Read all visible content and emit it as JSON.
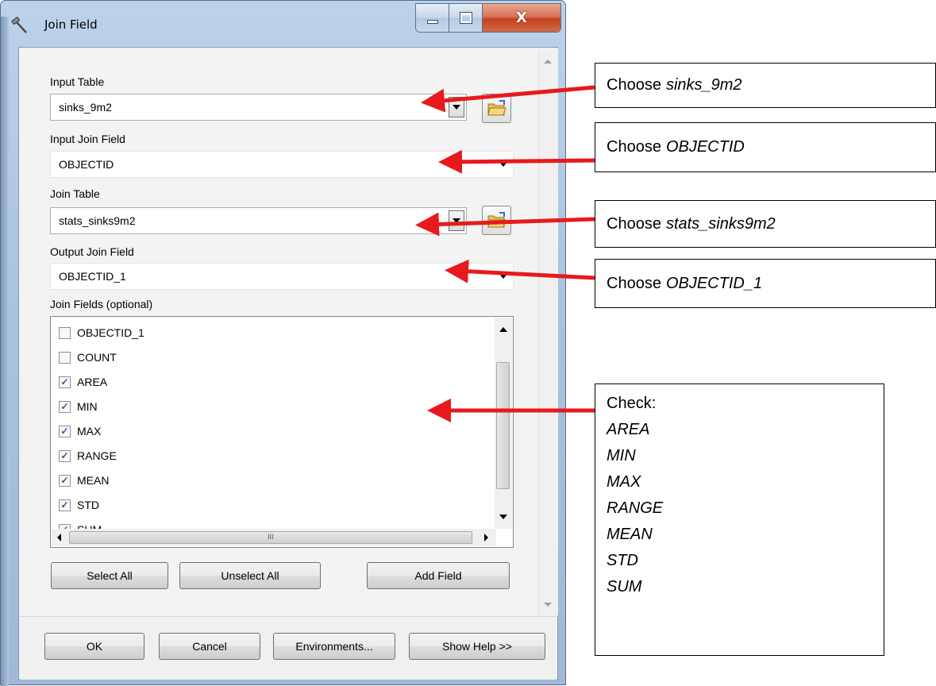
{
  "window": {
    "title": "Join Field",
    "icons": [
      "hammer-icon"
    ],
    "controls": {
      "minimize": "minimize",
      "maximize": "maximize",
      "close": "X"
    }
  },
  "form": {
    "input_table": {
      "label": "Input Table",
      "value": "sinks_9m2"
    },
    "input_join_field": {
      "label": "Input Join Field",
      "value": "OBJECTID"
    },
    "join_table": {
      "label": "Join Table",
      "value": "stats_sinks9m2"
    },
    "output_join_field": {
      "label": "Output Join Field",
      "value": "OBJECTID_1"
    },
    "join_fields": {
      "label": "Join Fields (optional)",
      "items": [
        {
          "name": "OBJECTID_1",
          "checked": false
        },
        {
          "name": "COUNT",
          "checked": false
        },
        {
          "name": "AREA",
          "checked": true
        },
        {
          "name": "MIN",
          "checked": true
        },
        {
          "name": "MAX",
          "checked": true
        },
        {
          "name": "RANGE",
          "checked": true
        },
        {
          "name": "MEAN",
          "checked": true
        },
        {
          "name": "STD",
          "checked": true
        },
        {
          "name": "SUM",
          "checked": true
        }
      ],
      "hscroll_grip": "III"
    },
    "buttons": {
      "select_all": "Select All",
      "unselect_all": "Unselect All",
      "add_field": "Add Field"
    }
  },
  "footer": {
    "ok": "OK",
    "cancel": "Cancel",
    "environments": "Environments...",
    "show_help": "Show Help >>"
  },
  "annotations": {
    "prefix": "Choose",
    "note1": "sinks_9m2",
    "note2": "OBJECTID",
    "note3": "stats_sinks9m2",
    "note4": "OBJECTID_1",
    "check_label": "Check:",
    "check_items": [
      "AREA",
      "MIN",
      "MAX",
      "RANGE",
      "MEAN",
      "STD",
      "SUM"
    ],
    "arrow_color": "#e8191c"
  }
}
